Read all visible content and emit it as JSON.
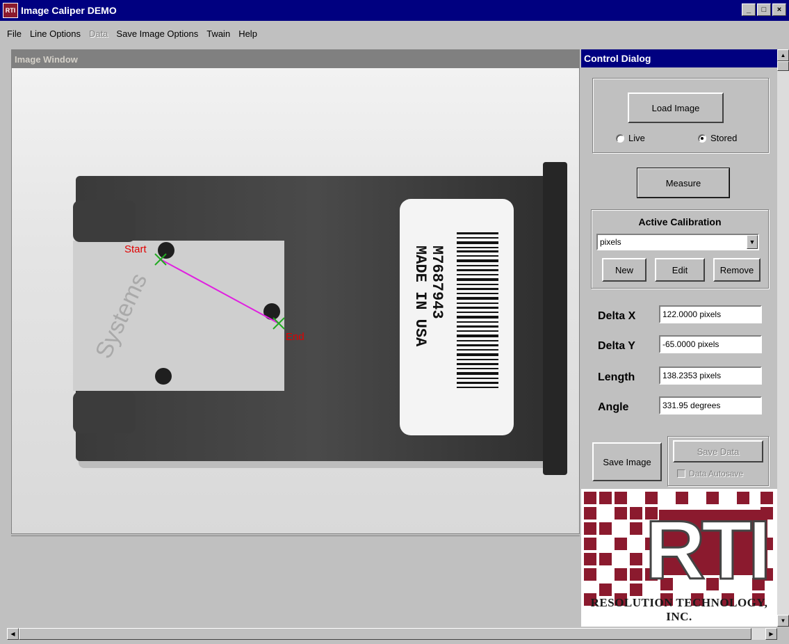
{
  "window": {
    "title": "Image Caliper DEMO",
    "app_icon_text": "RTI",
    "minimize_label": "_",
    "maximize_label": "□",
    "close_label": "×"
  },
  "menu": {
    "items": [
      {
        "label": "File",
        "enabled": true
      },
      {
        "label": "Line Options",
        "enabled": true
      },
      {
        "label": "Data",
        "enabled": false
      },
      {
        "label": "Save Image Options",
        "enabled": true
      },
      {
        "label": "Twain",
        "enabled": true
      },
      {
        "label": "Help",
        "enabled": true
      }
    ]
  },
  "image_window": {
    "title": "Image Window",
    "barcode_text_line1": "M7687943",
    "barcode_text_line2": "MADE IN USA",
    "background_label_fragment": "Systems",
    "start_label": "Start",
    "end_label": "End",
    "measure_line_color": "#e020e0",
    "marker_color": "#22aa22",
    "label_color": "#e00000"
  },
  "control_dialog": {
    "title": "Control Dialog",
    "load_image_label": "Load Image",
    "source": {
      "live_label": "Live",
      "stored_label": "Stored",
      "selected": "Stored"
    },
    "measure_label": "Measure",
    "calibration": {
      "heading": "Active Calibration",
      "selected": "pixels",
      "new_label": "New",
      "edit_label": "Edit",
      "remove_label": "Remove"
    },
    "results": {
      "delta_x_label": "Delta X",
      "delta_x_value": "122.0000 pixels",
      "delta_y_label": "Delta Y",
      "delta_y_value": "-65.0000 pixels",
      "length_label": "Length",
      "length_value": "138.2353 pixels",
      "angle_label": "Angle",
      "angle_value": "331.95 degrees"
    },
    "save_image_label": "Save Image",
    "save_data_label": "Save Data",
    "data_autosave_label": "Data Autosave",
    "data_autosave_checked": false
  },
  "logo": {
    "letters": "RTI",
    "company": "RESOLUTION TECHNOLOGY, INC.",
    "brand_color": "#8b1a2e"
  }
}
